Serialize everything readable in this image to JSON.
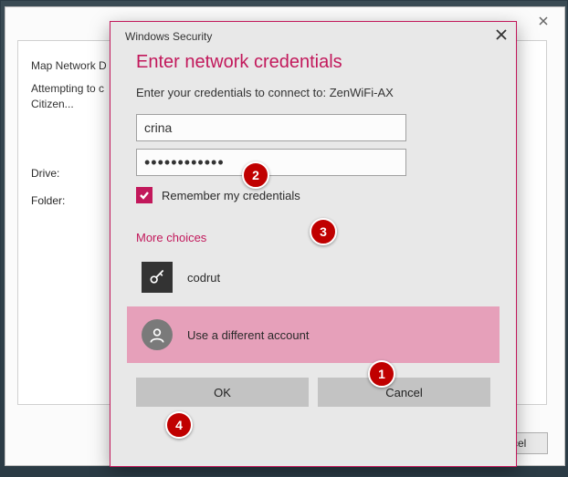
{
  "annotations": {
    "n1": "1",
    "n2": "2",
    "n3": "3",
    "n4": "4"
  },
  "outer_window": {
    "title": "Map Network D",
    "status_text": "Attempting to c\nCitizen...",
    "drive_label": "Drive:",
    "folder_label": "Folder:",
    "cancel_label": "ancel"
  },
  "security_dialog": {
    "window_title": "Windows Security",
    "heading": "Enter network credentials",
    "instruction": "Enter your credentials to connect to: ZenWiFi-AX",
    "username_value": "crina",
    "password_masked": "••••••••••••",
    "remember_label": "Remember my credentials",
    "remember_checked": true,
    "more_choices_label": "More choices",
    "saved_account_name": "codrut",
    "use_different_label": "Use a different account",
    "ok_label": "OK",
    "cancel_label": "Cancel"
  }
}
